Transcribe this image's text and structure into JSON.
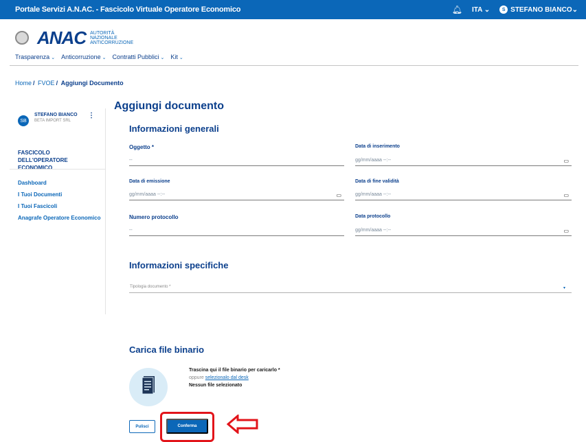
{
  "topbar": {
    "title": "Portale Servizi A.N.AC. - Fascicolo Virtuale Operatore Economico",
    "bell_icon": "bell-icon",
    "language": "ITA",
    "user_initial": "S",
    "user_name": "STEFANO BIANCO"
  },
  "brand": {
    "logo_text": "ANAC",
    "logo_sub": [
      "AUTORITÀ",
      "NAZIONALE",
      "ANTICORRUZIONE"
    ]
  },
  "nav": [
    "Trasparenza",
    "Anticorruzione",
    "Contratti Pubblici",
    "Kit"
  ],
  "breadcrumb": {
    "home": "Home",
    "fvoe": "FVOE",
    "current": "Aggiungi Documento"
  },
  "sidebar": {
    "avatar_initials": "SB",
    "user_name": "STEFANO BIANCO",
    "company": "BETA IMPORT SRL",
    "heading": "FASCICOLO DELL'OPERATORE ECONOMICO",
    "links": [
      "Dashboard",
      "I Tuoi Documenti",
      "I Tuoi Fascicoli",
      "Anagrafe Operatore Economico"
    ]
  },
  "main": {
    "page_title": "Aggiungi documento",
    "general_title": "Informazioni generali",
    "fields": {
      "oggetto_label": "Oggetto *",
      "oggetto_value": "--",
      "data_inserimento_label": "Data di inserimento",
      "data_inserimento_value": "gg/mm/aaaa --:--",
      "data_emissione_label": "Data di emissione",
      "data_emissione_value": "gg/mm/aaaa --:--",
      "data_fine_label": "Data di fine validità",
      "data_fine_value": "gg/mm/aaaa --:--",
      "numero_protocollo_label": "Numero protocollo",
      "numero_protocollo_value": "--",
      "data_protocollo_label": "Data protocollo",
      "data_protocollo_value": "gg/mm/aaaa --:--"
    },
    "specific_title": "Informazioni specifiche",
    "tipologia_placeholder": "Tipologia documento *",
    "upload_title": "Carica file binario",
    "upload_line1": "Trascina qui il file binario per caricarlo *",
    "upload_line2_prefix": "oppure",
    "upload_line2_link": "selezionalo dal desk",
    "upload_line3": "Nessun file selezionato",
    "clear_label": "Pulisci",
    "confirm_label": "Conferma"
  },
  "colors": {
    "brand_blue": "#0b67b8",
    "dark_blue": "#0b3f8c",
    "highlight_red": "#e2141a"
  }
}
